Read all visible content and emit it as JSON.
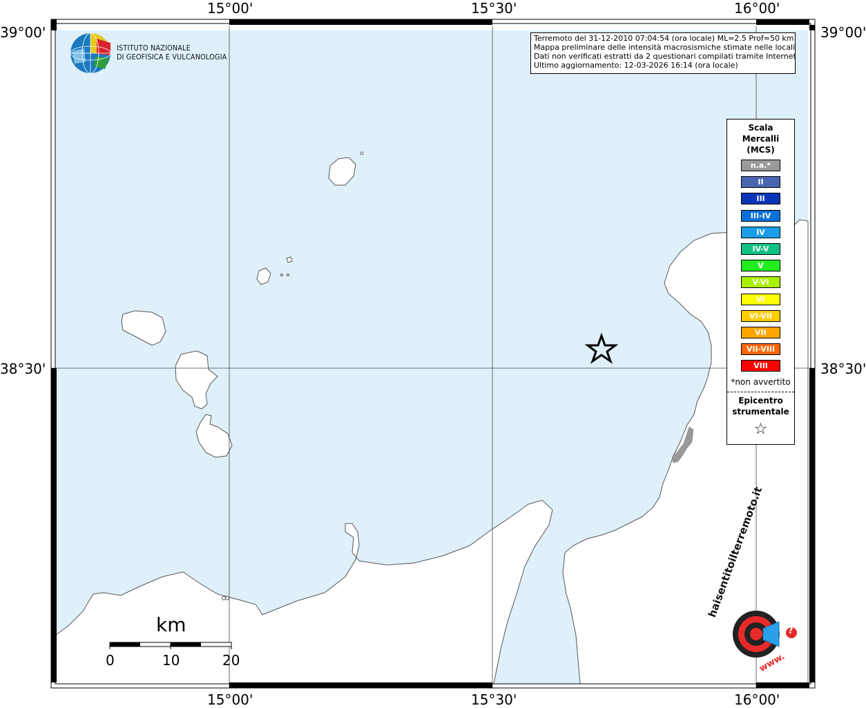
{
  "map": {
    "lat_labels": [
      "39°00'",
      "38°30'"
    ],
    "lon_labels": [
      "15°00'",
      "15°30'",
      "16°00'"
    ],
    "colors": {
      "sea": "#dff0fb",
      "land": "#ffffff",
      "coast": "#555555",
      "urban": "#999999"
    }
  },
  "logo": {
    "line1": "ISTITUTO NAZIONALE",
    "line2": "DI GEOFISICA E VULCANOLOGIA"
  },
  "info": {
    "line1": "Terremoto del 31-12-2010 07:04:54 (ora locale) ML=2.5 Prof=50 km",
    "line2": "Mappa preliminare delle intensità macrosismiche stimate nelle località",
    "line3": "Dati non verificati estratti da 2 questionari compilati tramite Internet.",
    "line4": "Ultimo aggiornamento: 12-03-2026 16:14 (ora locale)"
  },
  "legend": {
    "title1": "Scala",
    "title2": "Mercalli",
    "title3": "(MCS)",
    "items": [
      {
        "label": "n.a.*",
        "color": "#999999"
      },
      {
        "label": "II",
        "color": "#4a66b0"
      },
      {
        "label": "III",
        "color": "#0a35b8"
      },
      {
        "label": "III-IV",
        "color": "#0a70d8"
      },
      {
        "label": "IV",
        "color": "#1a9ee8"
      },
      {
        "label": "IV-V",
        "color": "#10c080"
      },
      {
        "label": "V",
        "color": "#22ee22"
      },
      {
        "label": "V-VI",
        "color": "#aaee00"
      },
      {
        "label": "VI",
        "color": "#ffff00"
      },
      {
        "label": "VI-VII",
        "color": "#ffcc00"
      },
      {
        "label": "VII",
        "color": "#ffa500"
      },
      {
        "label": "VII-VIII",
        "color": "#ff6600"
      },
      {
        "label": "VIII",
        "color": "#ff0000"
      }
    ],
    "note": "*non avvertito",
    "epi1": "Epicentro",
    "epi2": "strumentale",
    "star": "☆"
  },
  "scalebar": {
    "unit": "km",
    "labels": [
      "0",
      "10",
      "20"
    ]
  },
  "site_logo": {
    "text": "haisentitoilterremoto.it",
    "www": "www.",
    "q": "?"
  }
}
